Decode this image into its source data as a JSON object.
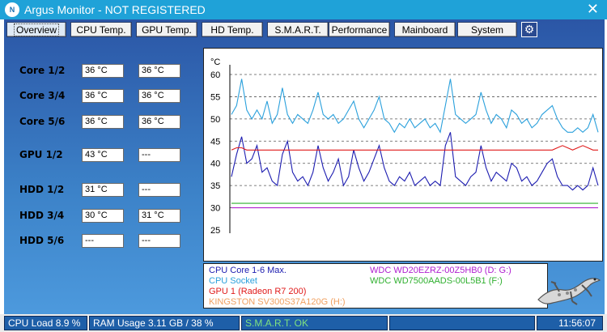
{
  "window": {
    "title": "Argus Monitor - NOT REGISTERED",
    "logo_text": "N",
    "close_glyph": "✕"
  },
  "tabs": [
    {
      "label": "Overview",
      "active": true
    },
    {
      "label": "CPU Temp.",
      "active": false
    },
    {
      "label": "GPU Temp.",
      "active": false
    },
    {
      "label": "HD Temp.",
      "active": false
    },
    {
      "label": "S.M.A.R.T.",
      "active": false
    },
    {
      "label": "Performance",
      "active": false
    },
    {
      "label": "Mainboard",
      "active": false
    },
    {
      "label": "System",
      "active": false
    }
  ],
  "settings_icon": "gear-icon",
  "sensors": [
    {
      "label": "Core 1/2",
      "v1": "36 °C",
      "v2": "36 °C"
    },
    {
      "label": "Core 3/4",
      "v1": "36 °C",
      "v2": "36 °C"
    },
    {
      "label": "Core 5/6",
      "v1": "36 °C",
      "v2": "36 °C"
    },
    {
      "label": "GPU 1/2",
      "v1": "43 °C",
      "v2": "---"
    },
    {
      "label": "HDD 1/2",
      "v1": "31 °C",
      "v2": "---"
    },
    {
      "label": "HDD 3/4",
      "v1": "30 °C",
      "v2": "31 °C"
    },
    {
      "label": "HDD 5/6",
      "v1": "---",
      "v2": "---"
    }
  ],
  "chart_data": {
    "type": "line",
    "title": "",
    "ylabel": "°C",
    "ylim": [
      25,
      62
    ],
    "yticks": [
      60,
      55,
      50,
      45,
      40,
      35,
      30,
      25
    ],
    "grid": "horizontal dashed",
    "series": [
      {
        "name": "CPU Core 1-6 Max.",
        "color": "#1c1cb0",
        "values": [
          37,
          42,
          46,
          40,
          41,
          44,
          38,
          39,
          36,
          35,
          42,
          45,
          38,
          36,
          37,
          35,
          38,
          44,
          39,
          36,
          38,
          41,
          35,
          37,
          43,
          39,
          36,
          38,
          41,
          44,
          39,
          36,
          35,
          37,
          36,
          38,
          35,
          36,
          37,
          35,
          36,
          35,
          44,
          47,
          37,
          36,
          35,
          37,
          38,
          44,
          39,
          36,
          38,
          37,
          36,
          40,
          39,
          36,
          37,
          35,
          36,
          38,
          40,
          41,
          37,
          35,
          35,
          34,
          35,
          34,
          35,
          39,
          35
        ]
      },
      {
        "name": "CPU Socket",
        "color": "#2aa0dc",
        "values": [
          51,
          53,
          59,
          52,
          50,
          52,
          50,
          54,
          49,
          51,
          57,
          51,
          49,
          51,
          50,
          49,
          52,
          56,
          51,
          50,
          51,
          49,
          50,
          52,
          54,
          50,
          48,
          50,
          52,
          55,
          50,
          49,
          47,
          49,
          48,
          50,
          48,
          49,
          50,
          48,
          49,
          47,
          53,
          59,
          51,
          50,
          49,
          50,
          51,
          56,
          52,
          49,
          51,
          50,
          48,
          52,
          51,
          49,
          50,
          48,
          49,
          51,
          52,
          53,
          50,
          48,
          47,
          47,
          48,
          47,
          48,
          51,
          47
        ]
      },
      {
        "name": "GPU 1 (Radeon R7 200)",
        "color": "#e01a1a",
        "values": [
          43,
          43.5,
          43.5,
          43,
          43,
          43,
          43,
          43,
          43,
          43,
          43,
          43,
          43,
          43,
          43,
          43,
          43,
          43,
          43,
          43,
          43,
          43,
          43,
          43,
          43,
          43,
          43,
          43,
          43,
          43,
          43,
          43,
          43,
          43,
          43,
          43,
          43,
          43,
          43,
          43,
          43,
          43,
          43,
          43,
          43,
          43,
          43,
          43,
          43,
          43,
          43,
          43,
          43,
          43,
          43,
          43,
          43,
          43,
          43,
          43,
          43,
          43,
          43,
          43,
          43.5,
          44,
          43.5,
          43,
          43.5,
          44,
          43.5,
          43,
          43
        ]
      },
      {
        "name": "KINGSTON SV300S37A120G (H:)",
        "color": "#f0a060",
        "values": []
      },
      {
        "name": "WDC WD20EZRZ-00Z5HB0 (D: G:)",
        "color": "#b020d0",
        "values": [
          30,
          30,
          30,
          30,
          30,
          30,
          30,
          30,
          30,
          30,
          30,
          30,
          30,
          30,
          30,
          30,
          30,
          30,
          30,
          30,
          30,
          30,
          30,
          30,
          30,
          30,
          30,
          30,
          30,
          30,
          30,
          30,
          30,
          30,
          30,
          30,
          30,
          30,
          30,
          30,
          30,
          30,
          30,
          30,
          30,
          30,
          30,
          30,
          30,
          30,
          30,
          30,
          30,
          30,
          30,
          30,
          30,
          30,
          30,
          30,
          30,
          30,
          30,
          30,
          30,
          30,
          30,
          30,
          30,
          30,
          30,
          30,
          30
        ]
      },
      {
        "name": "WDC WD7500AADS-00L5B1 (F:)",
        "color": "#30b030",
        "values": [
          31,
          31,
          31,
          31,
          31,
          31,
          31,
          31,
          31,
          31,
          31,
          31,
          31,
          31,
          31,
          31,
          31,
          31,
          31,
          31,
          31,
          31,
          31,
          31,
          31,
          31,
          31,
          31,
          31,
          31,
          31,
          31,
          31,
          31,
          31,
          31,
          31,
          31,
          31,
          31,
          31,
          31,
          31,
          31,
          31,
          31,
          31,
          31,
          31,
          31,
          31,
          31,
          31,
          31,
          31,
          31,
          31,
          31,
          31,
          31,
          31,
          31,
          31,
          31,
          31,
          31,
          31,
          31,
          31,
          31,
          31,
          31,
          31
        ]
      }
    ]
  },
  "legend": {
    "items": [
      {
        "text": "CPU Core 1-6 Max.",
        "color": "#1c1cb0"
      },
      {
        "text": "CPU Socket",
        "color": "#2aa0dc"
      },
      {
        "text": "GPU 1 (Radeon R7 200)",
        "color": "#e01a1a"
      },
      {
        "text": "KINGSTON SV300S37A120G (H:)",
        "color": "#f0a060"
      },
      {
        "text": "WDC WD20EZRZ-00Z5HB0 (D: G:)",
        "color": "#b020d0"
      },
      {
        "text": "WDC WD7500AADS-00L5B1 (F:)",
        "color": "#30b030"
      }
    ]
  },
  "statusbar": {
    "cpu_load": "CPU Load 8.9 %",
    "ram_usage": "RAM Usage 3.11 GB / 38 %",
    "smart": "S.M.A.R.T. OK",
    "time": "11:56:07"
  },
  "colors": {
    "titlebar": "#1fa2d8",
    "window_top": "#2b56a6",
    "window_bottom": "#4f9de0",
    "status_bg": "#1e5fa8"
  }
}
